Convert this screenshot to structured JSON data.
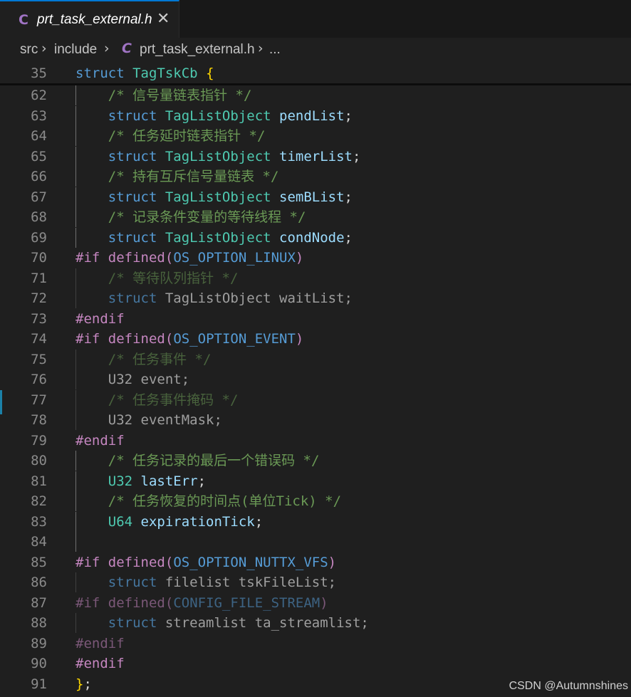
{
  "tab": {
    "icon": "C",
    "label": "prt_task_external.h",
    "close": "✕"
  },
  "breadcrumb": {
    "items": [
      "src",
      "include",
      "prt_task_external.h",
      "..."
    ],
    "separator": "›",
    "file_icon": "C"
  },
  "sticky": {
    "line": "35",
    "code": "struct TagTskCb {"
  },
  "lines": [
    {
      "n": "62",
      "text": "/* 信号量链表指针 */"
    },
    {
      "n": "63",
      "text": "struct TagListObject pendList;"
    },
    {
      "n": "64",
      "text": "/* 任务延时链表指针 */"
    },
    {
      "n": "65",
      "text": "struct TagListObject timerList;"
    },
    {
      "n": "66",
      "text": "/* 持有互斥信号量链表 */"
    },
    {
      "n": "67",
      "text": "struct TagListObject semBList;"
    },
    {
      "n": "68",
      "text": "/* 记录条件变量的等待线程 */"
    },
    {
      "n": "69",
      "text": "struct TagListObject condNode;"
    },
    {
      "n": "70",
      "text": "#if defined(OS_OPTION_LINUX)"
    },
    {
      "n": "71",
      "text": "/* 等待队列指针 */"
    },
    {
      "n": "72",
      "text": "struct TagListObject waitList;"
    },
    {
      "n": "73",
      "text": "#endif"
    },
    {
      "n": "74",
      "text": "#if defined(OS_OPTION_EVENT)"
    },
    {
      "n": "75",
      "text": "/* 任务事件 */"
    },
    {
      "n": "76",
      "text": "U32 event;"
    },
    {
      "n": "77",
      "text": "/* 任务事件掩码 */"
    },
    {
      "n": "78",
      "text": "U32 eventMask;"
    },
    {
      "n": "79",
      "text": "#endif"
    },
    {
      "n": "80",
      "text": "/* 任务记录的最后一个错误码 */"
    },
    {
      "n": "81",
      "text": "U32 lastErr;"
    },
    {
      "n": "82",
      "text": "/* 任务恢复的时间点(单位Tick) */"
    },
    {
      "n": "83",
      "text": "U64 expirationTick;"
    },
    {
      "n": "84",
      "text": ""
    },
    {
      "n": "85",
      "text": "#if defined(OS_OPTION_NUTTX_VFS)"
    },
    {
      "n": "86",
      "text": "struct filelist tskFileList;"
    },
    {
      "n": "87",
      "text": "#if defined(CONFIG_FILE_STREAM)"
    },
    {
      "n": "88",
      "text": "struct streamlist ta_streamlist;"
    },
    {
      "n": "89",
      "text": "#endif"
    },
    {
      "n": "90",
      "text": "#endif"
    },
    {
      "n": "91",
      "text": "};"
    }
  ],
  "watermark": "CSDN @Autumnshines",
  "colors": {
    "background": "#1f1f1f",
    "keyword": "#569cd6",
    "type": "#4ec9b0",
    "variable": "#9cdcfe",
    "comment": "#6a9955",
    "preprocessor": "#c586c0",
    "brace": "#ffd700",
    "line_number": "#8a8a8a"
  }
}
